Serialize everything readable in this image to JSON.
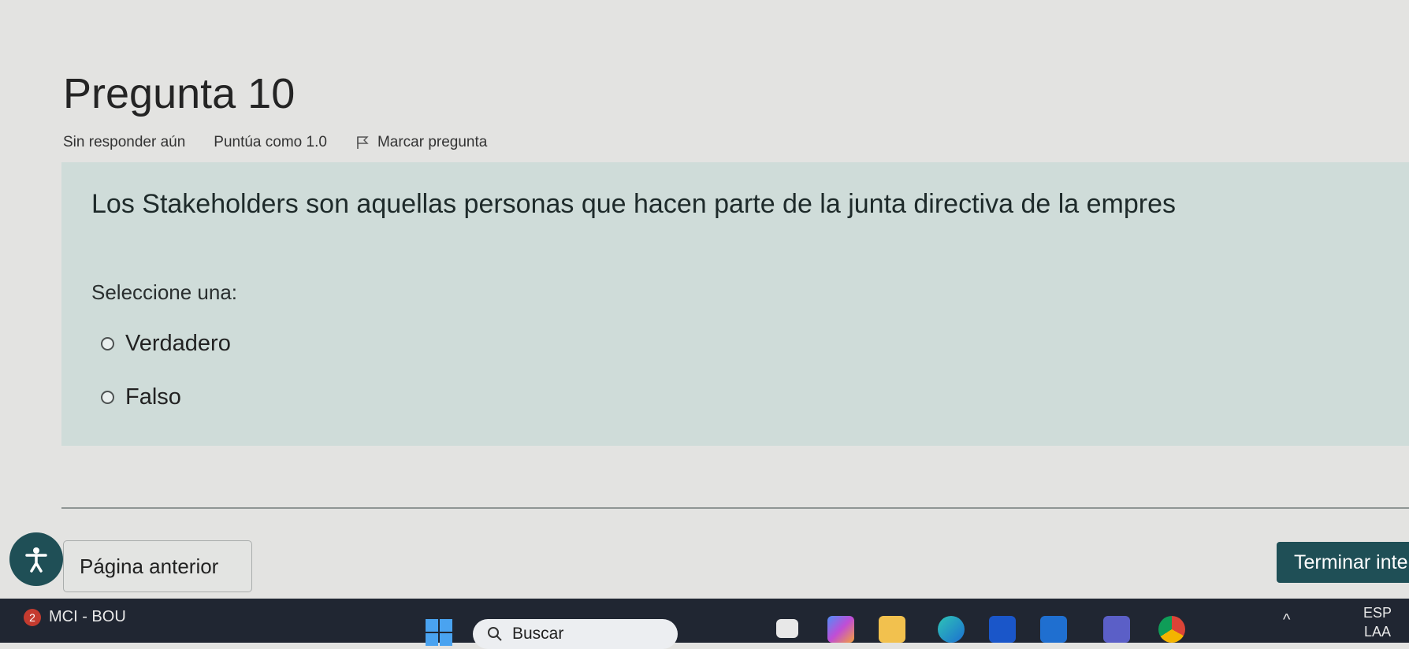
{
  "question": {
    "title": "Pregunta 10",
    "status": "Sin responder aún",
    "score": "Puntúa como 1.0",
    "flag_label": "Marcar pregunta",
    "text": "Los Stakeholders son aquellas personas que hacen parte de la junta directiva de la empres",
    "prompt": "Seleccione una:",
    "options": [
      {
        "label": "Verdadero",
        "selected": false
      },
      {
        "label": "Falso",
        "selected": false
      }
    ]
  },
  "navigation": {
    "prev_label": "Página anterior",
    "finish_label": "Terminar inten"
  },
  "taskbar": {
    "notification_count": "2",
    "app_label": "MCI - BOU",
    "search_placeholder": "Buscar",
    "lang": "ESP",
    "region": "LAA"
  },
  "colors": {
    "question_box": "#cfdcd9",
    "primary_button": "#1f4f56",
    "taskbar": "#202632"
  }
}
